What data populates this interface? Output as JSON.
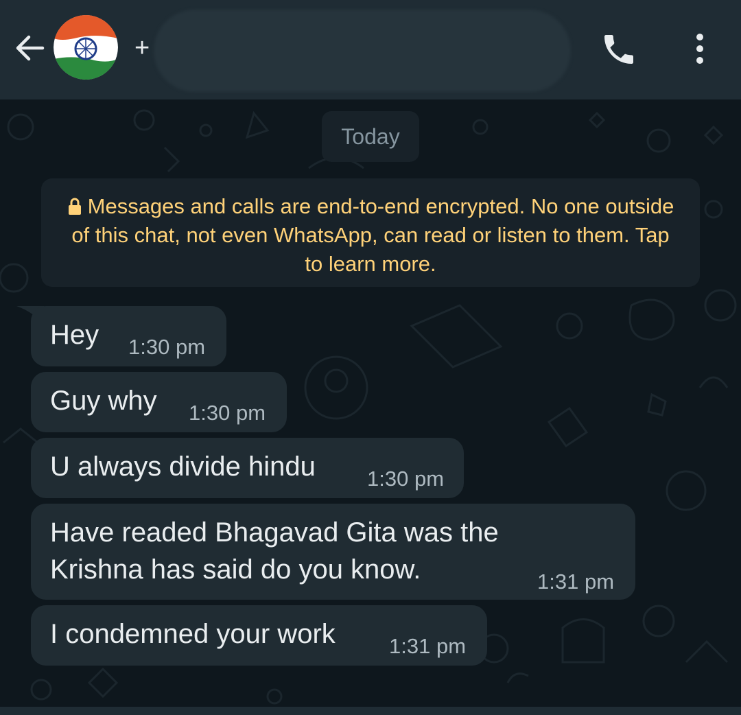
{
  "header": {
    "contact_prefix": "+",
    "back_icon": "arrow-left-icon",
    "call_icon": "phone-icon",
    "menu_icon": "more-vertical-icon"
  },
  "chat": {
    "date_label": "Today",
    "encryption_notice": "Messages and calls are end-to-end encrypted. No one outside of this chat, not even WhatsApp, can read or listen to them. Tap to learn more.",
    "messages": [
      {
        "text": "Hey",
        "time": "1:30 pm"
      },
      {
        "text": "Guy why",
        "time": "1:30 pm"
      },
      {
        "text": "U always divide hindu",
        "time": "1:30 pm"
      },
      {
        "text": "Have readed Bhagavad Gita was the",
        "text2": "Krishna has said do you know.",
        "time": "1:31 pm"
      },
      {
        "text": "I condemned your work",
        "time": "1:31 pm"
      }
    ]
  },
  "colors": {
    "header_bg": "#1f2c34",
    "chat_bg": "#0b141a",
    "bubble_bg": "#202c33",
    "notice_text": "#ffd279",
    "text_primary": "#e9edef",
    "text_secondary": "#aebac1"
  }
}
